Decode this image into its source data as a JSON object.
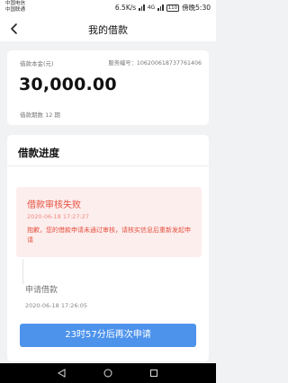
{
  "status_bar": {
    "carrier_1": "中国电信",
    "carrier_2": "中国联通",
    "speed": "6.5K/s",
    "network": "4G",
    "battery": "110",
    "time": "傍晚5:30"
  },
  "nav": {
    "title": "我的借款",
    "back_icon": "chevron-left-icon"
  },
  "loan": {
    "amount_label": "借款本金(元)",
    "serial": "服务编号：106200618737761406",
    "amount": "30,000.00",
    "period": "借款期数 12 期"
  },
  "progress": {
    "title": "借款进度",
    "failed": {
      "title": "借款审核失败",
      "time": "2020-06-18 17:27:27",
      "description": "抱歉，您的借款申请未通过审核，请核实信息后重新发起申请"
    },
    "applied": {
      "title": "申请借款",
      "time": "2020-06-18 17:26:05"
    }
  },
  "action": {
    "label": "23时57分后再次申请"
  },
  "colors": {
    "accent": "#4d93ec",
    "error": "#e5513f",
    "error_bg": "#fdeeee"
  }
}
